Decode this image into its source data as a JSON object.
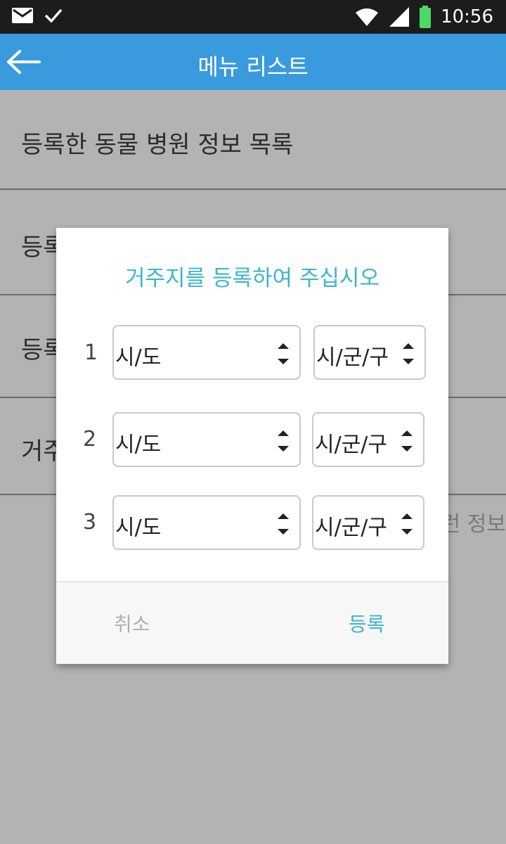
{
  "status_bar": {
    "time": "10:56",
    "battery_color": "#4cd964"
  },
  "app_bar": {
    "title": "메뉴 리스트",
    "color": "#3a9ade"
  },
  "menu_items": [
    "등록한 동물 병원 정보 목록",
    "등록",
    "등록",
    "거주"
  ],
  "background_hint": "런 정보",
  "dialog": {
    "title": "거주지를 등록하여 주십시오",
    "accent_color": "#3db5cc",
    "rows": [
      {
        "number": "1",
        "province": "시/도",
        "district": "시/군/구"
      },
      {
        "number": "2",
        "province": "시/도",
        "district": "시/군/구"
      },
      {
        "number": "3",
        "province": "시/도",
        "district": "시/군/구"
      }
    ],
    "cancel_label": "취소",
    "register_label": "등록"
  }
}
